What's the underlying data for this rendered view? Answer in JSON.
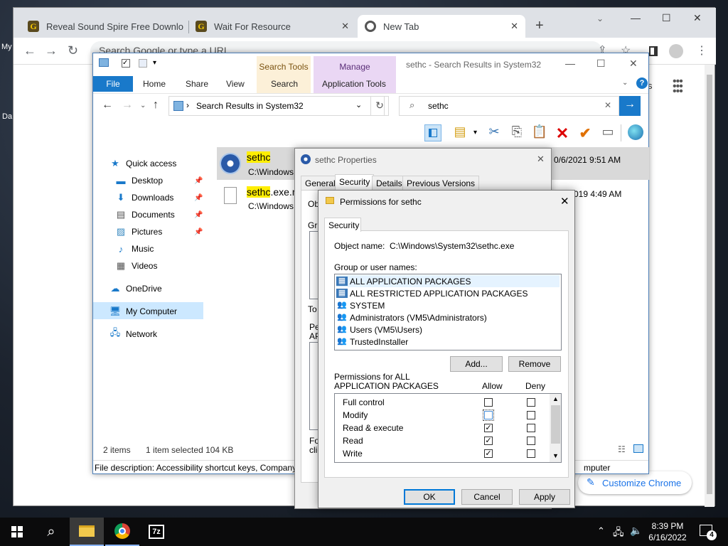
{
  "desktop": {
    "label_my": "My",
    "label_da": "Da"
  },
  "chrome": {
    "tabs": [
      {
        "title": "Reveal Sound Spire Free Downlo"
      },
      {
        "title": "Wait For Resource"
      },
      {
        "title": "New Tab"
      }
    ],
    "omnibox_placeholder": "Search Google or type a URL",
    "customize_label": "Customize Chrome",
    "side_s": "s"
  },
  "explorer": {
    "title": "sethc - Search Results in System32",
    "ribbon": {
      "file": "File",
      "home": "Home",
      "share": "Share",
      "view": "View",
      "search_tools": "Search Tools",
      "search": "Search",
      "manage": "Manage",
      "application_tools": "Application Tools"
    },
    "address": "Search Results in System32",
    "search_value": "sethc",
    "nav": [
      {
        "label": "Quick access"
      },
      {
        "label": "Desktop"
      },
      {
        "label": "Downloads"
      },
      {
        "label": "Documents"
      },
      {
        "label": "Pictures"
      },
      {
        "label": "Music"
      },
      {
        "label": "Videos"
      },
      {
        "label": "OneDrive"
      },
      {
        "label": "My Computer"
      },
      {
        "label": "Network"
      }
    ],
    "files": [
      {
        "name": "sethc",
        "path": "C:\\Windows",
        "date": "0/6/2021 9:51 AM"
      },
      {
        "name_hl": "sethc",
        "name_rest": ".exe.m",
        "path": "C:\\Windows",
        "date": "019 4:49 AM"
      }
    ],
    "status_items": "2 items",
    "status_selected": "1 item selected  104 KB",
    "description": "File description: Accessibility shortcut keys, Company",
    "desc_tail": "mputer"
  },
  "props": {
    "title": "sethc Properties",
    "tabs": [
      "General",
      "Security",
      "Details",
      "Previous Versions"
    ],
    "partial": {
      "ob": "Ob",
      "gr": "Gr",
      "to": "To",
      "pe": "Pe",
      "ap": "AP",
      "fo": "Fo",
      "cli": "clic"
    }
  },
  "perm": {
    "title": "Permissions for sethc",
    "tab": "Security",
    "object_label": "Object name:",
    "object_value": "C:\\Windows\\System32\\sethc.exe",
    "group_label": "Group or user names:",
    "users": [
      {
        "name": "ALL APPLICATION PACKAGES"
      },
      {
        "name": "ALL RESTRICTED APPLICATION PACKAGES"
      },
      {
        "name": "SYSTEM"
      },
      {
        "name": "Administrators (VM5\\Administrators)"
      },
      {
        "name": "Users (VM5\\Users)"
      },
      {
        "name": "TrustedInstaller"
      }
    ],
    "add_label": "Add...",
    "remove_label": "Remove",
    "perms_for_line1": "Permissions for ALL",
    "perms_for_line2": "APPLICATION PACKAGES",
    "allow_label": "Allow",
    "deny_label": "Deny",
    "permissions": [
      {
        "name": "Full control",
        "allow": false,
        "deny": false
      },
      {
        "name": "Modify",
        "allow": false,
        "deny": false
      },
      {
        "name": "Read & execute",
        "allow": true,
        "deny": false
      },
      {
        "name": "Read",
        "allow": true,
        "deny": false
      },
      {
        "name": "Write",
        "allow": true,
        "deny": false
      }
    ],
    "ok_label": "OK",
    "cancel_label": "Cancel",
    "apply_label": "Apply"
  },
  "taskbar": {
    "time": "8:39 PM",
    "date": "6/16/2022",
    "notification_count": "4",
    "sevenzip_label": "7z"
  }
}
